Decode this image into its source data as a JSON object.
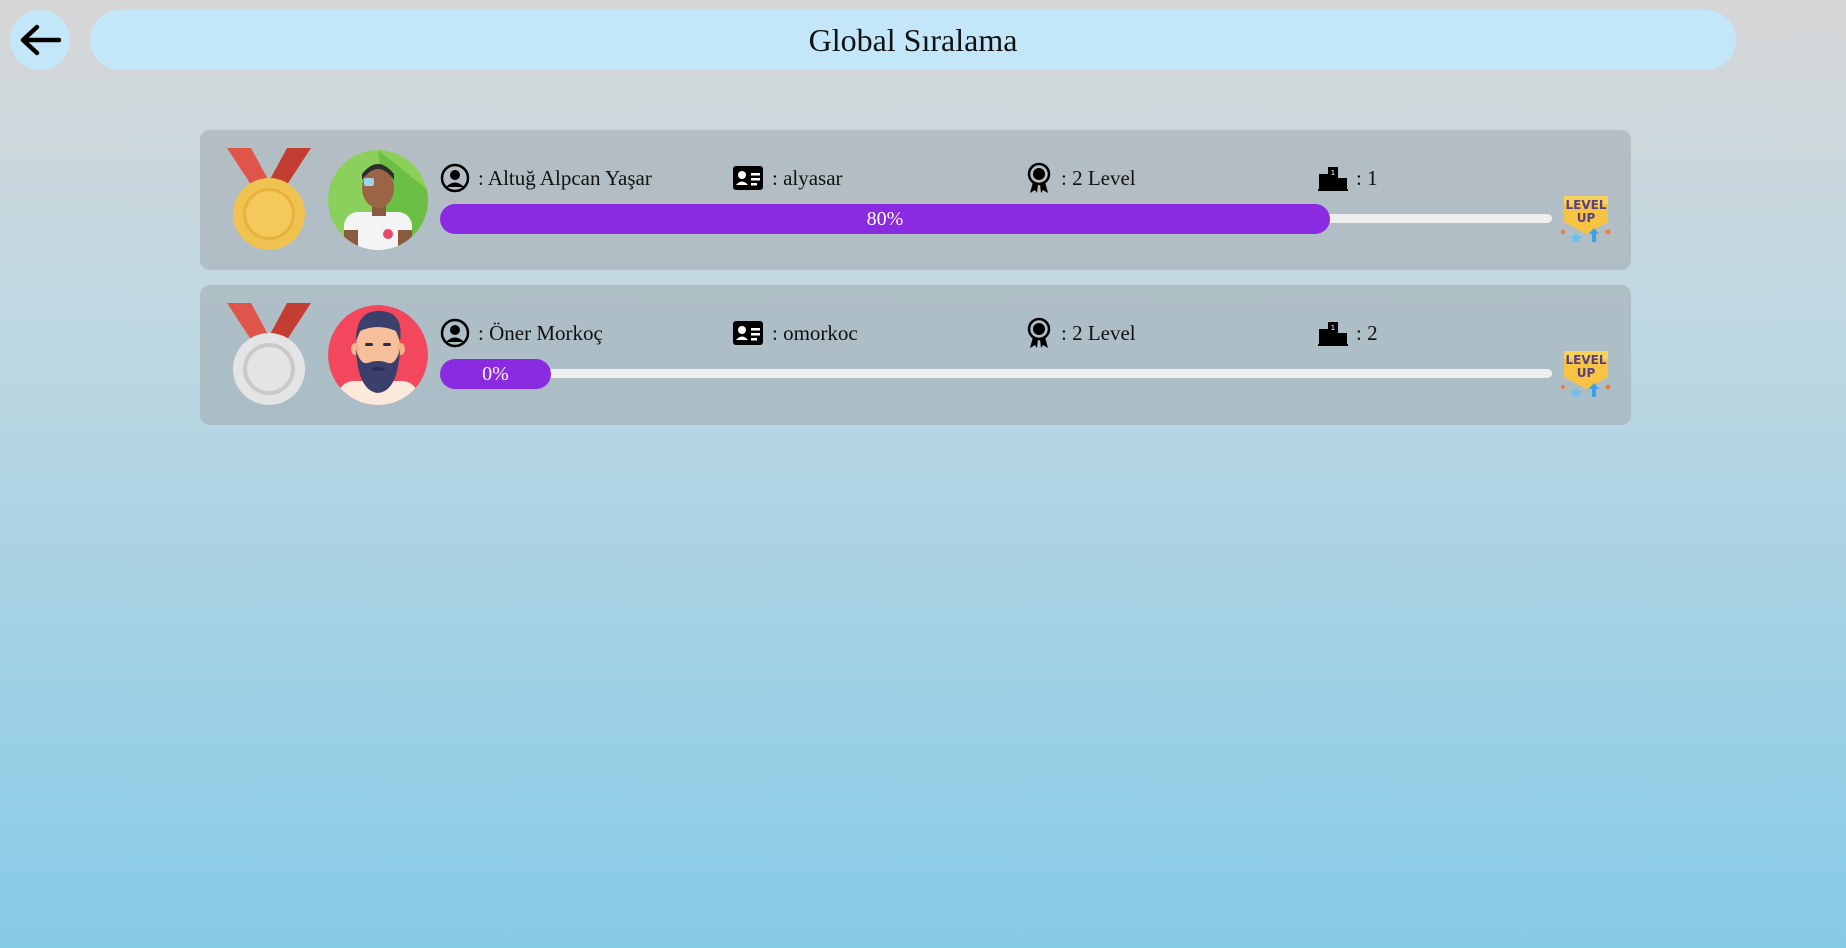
{
  "header": {
    "title": "Global Sıralama",
    "back_icon": "arrow-left-icon"
  },
  "colors": {
    "background_top": "#d6d6d6",
    "background_bottom": "#86cbe8",
    "header_bg": "#c3e6f8",
    "card_bg": "#abb6bb",
    "progress_fill": "#8a2be2",
    "progress_track": "#eeeeee"
  },
  "leaderboard": [
    {
      "medal": "gold-medal-icon",
      "avatar": "avatar-green-icon",
      "name": ": Altuğ Alpcan Yaşar",
      "username": ": alyasar",
      "level": ": 2 Level",
      "rank": ": 1",
      "progress": 0.8,
      "progress_label": "80%",
      "badge": "level-up-badge-icon"
    },
    {
      "medal": "silver-medal-icon",
      "avatar": "avatar-bearded-man-icon",
      "name": ": Öner Morkoç",
      "username": ": omorkoc",
      "level": ": 2 Level",
      "rank": ": 2",
      "progress": 0,
      "progress_label": "0%",
      "badge": "level-up-badge-icon"
    }
  ]
}
